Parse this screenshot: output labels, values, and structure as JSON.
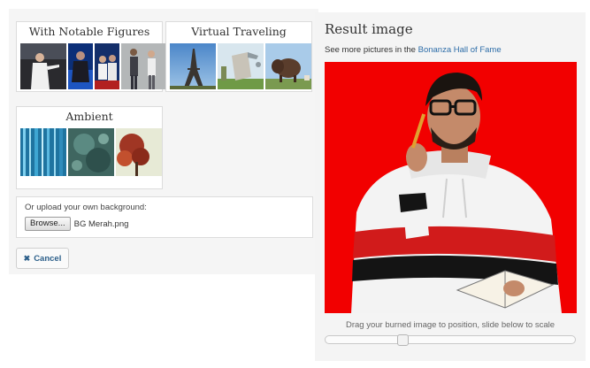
{
  "categories": [
    {
      "title": "With Notable Figures",
      "thumbs": [
        "speaker-on-stage",
        "presenter-in-blue-light",
        "two-men-seated",
        "people-walking"
      ]
    },
    {
      "title": "Virtual Traveling",
      "thumbs": [
        "eiffel-tower",
        "leaning-tower",
        "bison-statue"
      ]
    },
    {
      "title": "Ambient",
      "thumbs": [
        "blue-water-streaks",
        "teal-underwater",
        "autumn-tree"
      ]
    }
  ],
  "upload": {
    "label": "Or upload your own background:",
    "browse_label": "Browse...",
    "file_name": "BG Merah.png"
  },
  "cancel_label": "Cancel",
  "result": {
    "title": "Result image",
    "subtitle_prefix": "See more pictures in the ",
    "subtitle_link": "Bonanza Hall of Fame",
    "background_color": "#f20000",
    "drag_hint": "Drag your burned image to position, slide below to scale",
    "scale_fraction": 0.3
  }
}
